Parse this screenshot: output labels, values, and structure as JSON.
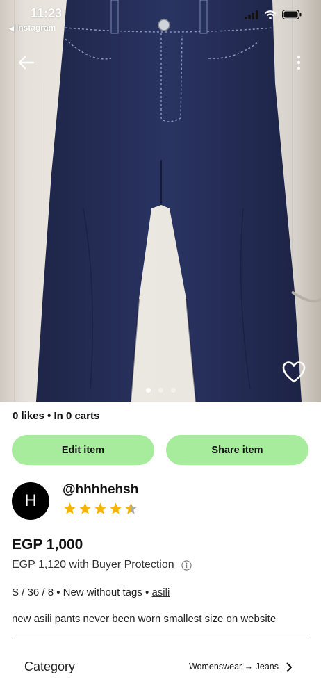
{
  "status_bar": {
    "time": "11:23",
    "back_app": "Instagram",
    "back_arrow_glyph": "◀"
  },
  "photo": {
    "carousel_count": 3,
    "active_index": 0
  },
  "item": {
    "likes_carts": "0 likes • In 0 carts",
    "edit_label": "Edit item",
    "share_label": "Share item"
  },
  "seller": {
    "initial": "H",
    "username": "@hhhhehsh",
    "rating": 4.5,
    "rating_max": 5
  },
  "pricing": {
    "price": "EGP 1,000",
    "price_with_protection": "EGP 1,120 with Buyer Protection"
  },
  "attributes": {
    "summary": "S / 36 / 8 • New without tags • ",
    "brand": "asili"
  },
  "description": "new asili pants never been worn smallest size on website",
  "category": {
    "label": "Category",
    "value": "Womenswear → Jeans"
  },
  "colors": {
    "button_bg": "#a6ec9c",
    "star": "#f5b400",
    "denim": "#232c52"
  },
  "icons": [
    "signal-icon",
    "wifi-icon",
    "battery-icon",
    "back-arrow-icon",
    "more-icon",
    "heart-icon",
    "star-icon",
    "info-icon",
    "chevron-right-icon"
  ]
}
